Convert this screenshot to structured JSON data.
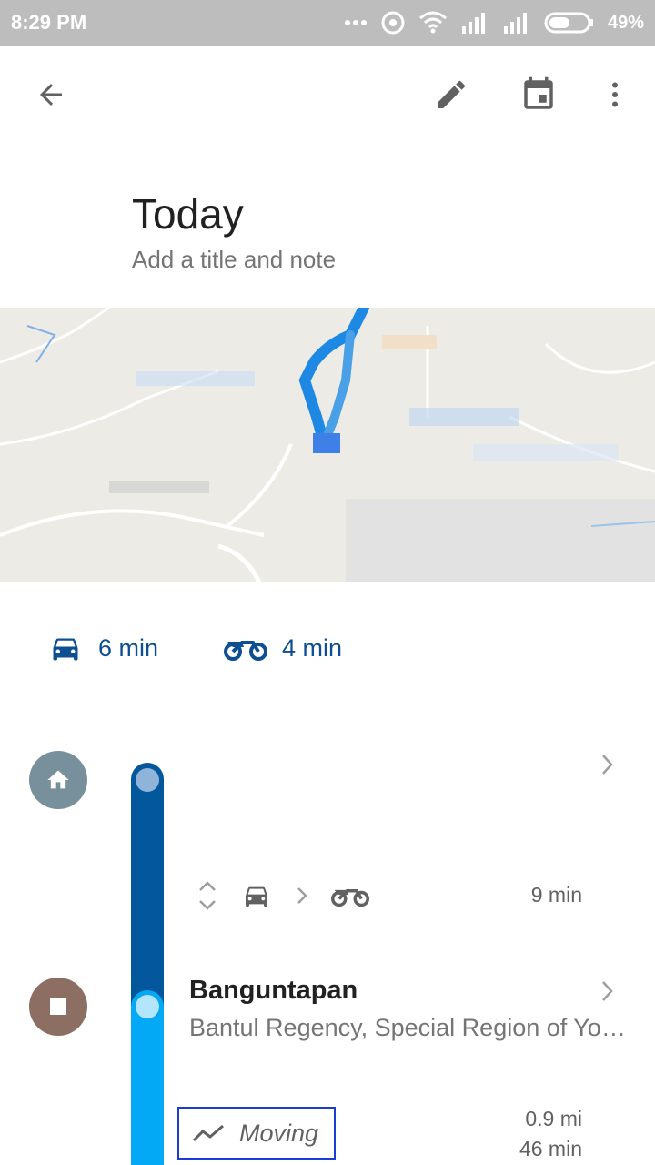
{
  "status_bar": {
    "time": "8:29 PM",
    "battery": "49%"
  },
  "header": {
    "title": "Today",
    "subtitle": "Add a title and note"
  },
  "modes": [
    {
      "label": "6 min",
      "icon": "car-icon"
    },
    {
      "label": "4 min",
      "icon": "motorcycle-icon"
    }
  ],
  "timeline": {
    "segment_duration": "9 min",
    "place": {
      "name": "Banguntapan",
      "address": "Bantul Regency, Special Region of Yogyakarta"
    },
    "activity": {
      "label": "Moving",
      "distance": "0.9 mi",
      "duration": "46 min"
    }
  },
  "colors": {
    "accent_dark": "#03579c",
    "accent_light": "#03a9f4",
    "home_circle": "#78909c",
    "stop_circle": "#8d6e63"
  }
}
